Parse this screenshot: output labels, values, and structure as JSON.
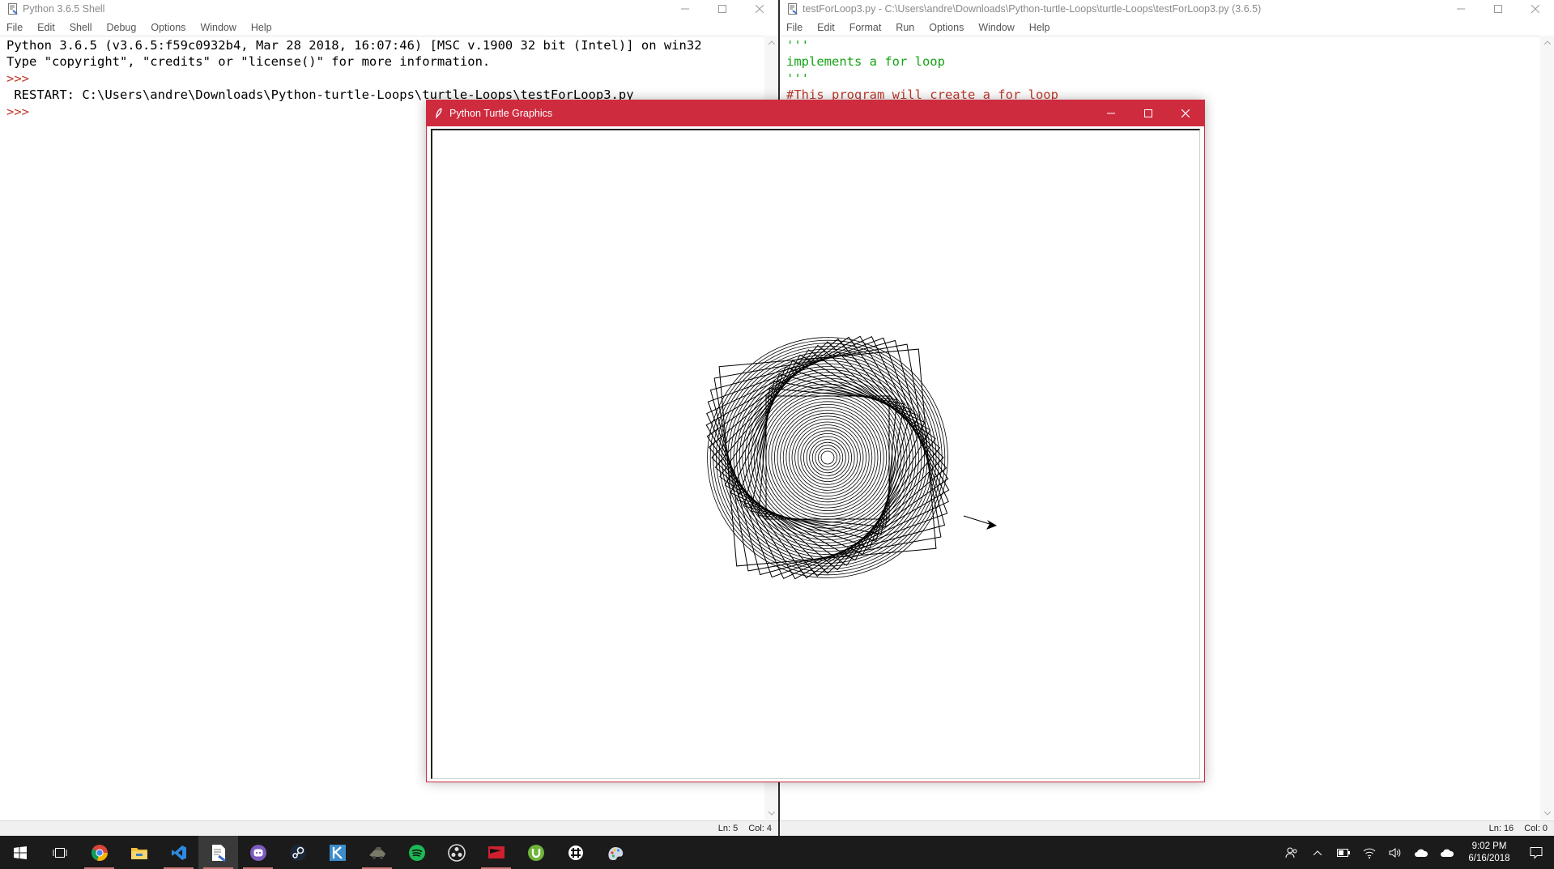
{
  "shell": {
    "title": "Python 3.6.5 Shell",
    "menu": [
      "File",
      "Edit",
      "Shell",
      "Debug",
      "Options",
      "Window",
      "Help"
    ],
    "banner": [
      "Python 3.6.5 (v3.6.5:f59c0932b4, Mar 28 2018, 16:07:46) [MSC v.1900 32 bit (Intel)] on win32",
      "Type \"copyright\", \"credits\" or \"license()\" for more information."
    ],
    "prompt": ">>>",
    "restart": " RESTART: C:\\Users\\andre\\Downloads\\Python-turtle-Loops\\turtle-Loops\\testForLoop3.py",
    "status": {
      "ln": "Ln: 5",
      "col": "Col: 4"
    }
  },
  "editor": {
    "title": "testForLoop3.py - C:\\Users\\andre\\Downloads\\Python-turtle-Loops\\turtle-Loops\\testForLoop3.py (3.6.5)",
    "menu": [
      "File",
      "Edit",
      "Format",
      "Run",
      "Options",
      "Window",
      "Help"
    ],
    "lines": [
      "'''",
      "implements a for loop",
      "'''",
      "#This program will create a for loop"
    ],
    "status": {
      "ln": "Ln: 16",
      "col": "Col: 0"
    }
  },
  "turtle_window": {
    "title": "Python Turtle Graphics"
  },
  "drawing": {
    "color": "#000000",
    "turtle_color": "#000000"
  },
  "taskbar": {
    "apps": [
      "start-icon",
      "task-view-icon",
      "chrome-icon",
      "file-explorer-icon",
      "vscode-icon",
      "idle-icon",
      "discord-icon",
      "steam-icon",
      "krita-icon",
      "game-icon",
      "spotify-icon",
      "obs-icon",
      "app-flag-icon",
      "utorrent-icon",
      "slack-icon",
      "paint-icon"
    ],
    "time": "9:02 PM",
    "date": "6/16/2018"
  },
  "colors": {
    "turtle_title_bg": "#cf2b3f",
    "prompt": "#c0392b",
    "string_green": "#16a316",
    "comment_red": "#c0392b"
  }
}
